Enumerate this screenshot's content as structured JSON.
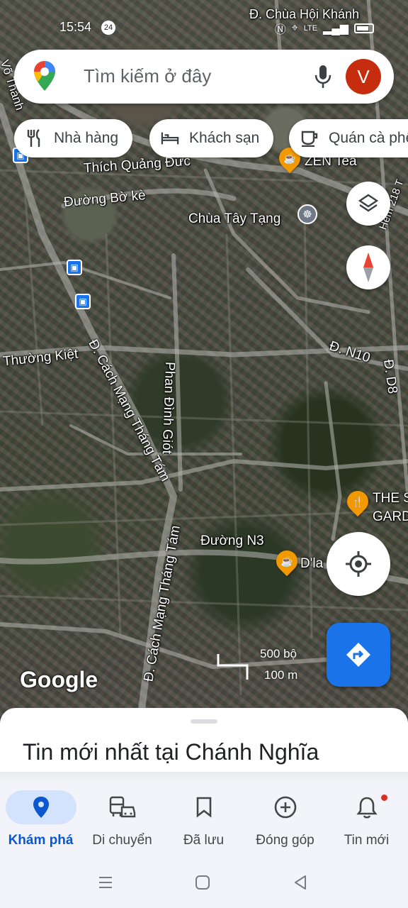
{
  "status_bar": {
    "time": "15:54",
    "notification_count": "24",
    "network_label": "LTE",
    "top_street_label": "Đ. Chùa Hội Khánh"
  },
  "search": {
    "placeholder": "Tìm kiếm ở đây",
    "avatar_initial": "V",
    "brand_colors": {
      "red": "#ea4335",
      "yellow": "#fbbc04",
      "green": "#34a853",
      "blue": "#4285f4"
    }
  },
  "chips": [
    {
      "label": "Nhà hàng",
      "icon": "restaurant-icon"
    },
    {
      "label": "Khách sạn",
      "icon": "hotel-icon"
    },
    {
      "label": "Quán cà phê",
      "icon": "coffee-icon"
    }
  ],
  "map": {
    "streets": [
      "Thích Quảng Đức",
      "Đường Bờ kè",
      "Thường Kiệt",
      "Đ. Cách Mạng Tháng Tám",
      "Phan Đình Giót",
      "Đ. N10",
      "Đ. D8",
      "Đường N3",
      "Đ. Cách Mạng Tháng Tám",
      "Võ Thành",
      "Hẻm 218 T"
    ],
    "places": [
      {
        "name": "ZEN Tea",
        "icon": "coffee-icon",
        "color": "#f29900"
      },
      {
        "name": "Chùa Tây Tạng",
        "icon": "temple-icon",
        "color": "#6f7a86"
      },
      {
        "name": "THE S GARD",
        "icon": "restaurant-icon",
        "color": "#f29900"
      },
      {
        "name": "D'la",
        "icon": "coffee-icon",
        "color": "#f29900"
      }
    ],
    "attribution": "Google",
    "scale": {
      "imperial": "500 bộ",
      "metric": "100 m"
    }
  },
  "sheet": {
    "title": "Tin mới nhất tại Chánh Nghĩa"
  },
  "bottom_nav": {
    "active_color": "#0b57d0",
    "items": [
      {
        "label": "Khám phá",
        "icon": "explore-pin-icon",
        "active": true
      },
      {
        "label": "Di chuyển",
        "icon": "commute-icon",
        "active": false
      },
      {
        "label": "Đã lưu",
        "icon": "bookmark-icon",
        "active": false
      },
      {
        "label": "Đóng góp",
        "icon": "add-circle-icon",
        "active": false
      },
      {
        "label": "Tin mới",
        "icon": "bell-icon",
        "active": false
      }
    ]
  }
}
